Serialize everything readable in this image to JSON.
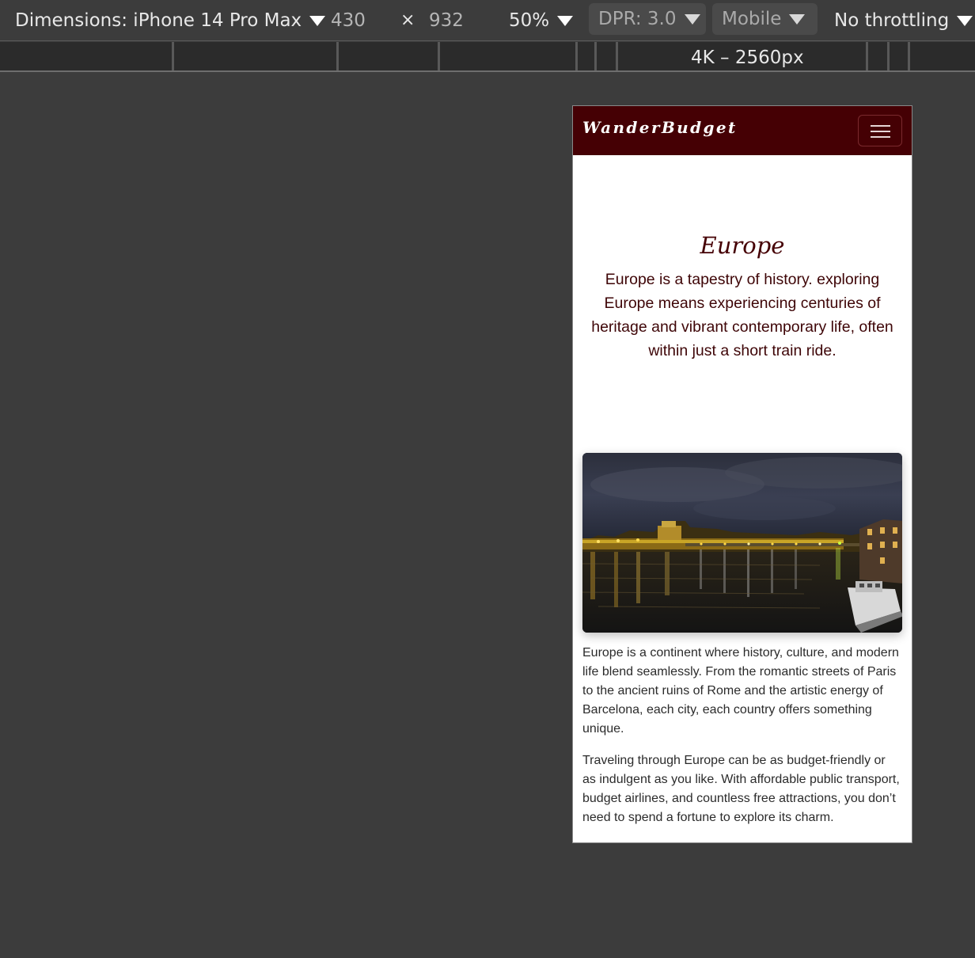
{
  "devtools": {
    "dimensions_label": "Dimensions: iPhone 14 Pro Max",
    "width": "430",
    "times": "×",
    "height": "932",
    "zoom": "50%",
    "dpr": "DPR: 3.0",
    "mode": "Mobile",
    "throttling": "No throttling",
    "ruler_label": "4K – 2560px"
  },
  "site": {
    "brand": "WanderBudget",
    "menu_icon": "hamburger-menu-icon",
    "hero": {
      "title": "Europe",
      "text": "Europe is a tapestry of history. exploring Europe means experiencing centuries of heritage and vibrant contemporary life, often within just a short train ride."
    },
    "image": {
      "subject": "river-city-night-photo"
    },
    "paragraphs": [
      "Europe is a continent where history, culture, and modern life blend seamlessly. From the romantic streets of Paris to the ancient ruins of Rome and the artistic energy of Barcelona, each city, each country offers something unique.",
      "Traveling through Europe can be as budget-friendly or as indulgent as you like. With affordable public transport, budget airlines, and countless free attractions, you don’t need to spend a fortune to explore its charm."
    ],
    "colors": {
      "navbar": "#450004",
      "heading": "#450004",
      "page_bg": "#3c3c3c"
    }
  }
}
